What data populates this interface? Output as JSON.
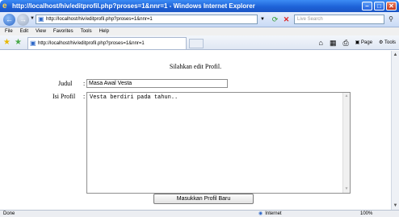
{
  "window": {
    "title": "http://localhost/hiv/editprofil.php?proses=1&nnr=1 - Windows Internet Explorer",
    "minimize_glyph": "–",
    "maximize_glyph": "□",
    "close_glyph": "✕"
  },
  "browser": {
    "address": "http://localhost/hiv/editprofil.php?proses=1&nnr=1",
    "search_placeholder": "Live Search",
    "menu": [
      "File",
      "Edit",
      "View",
      "Favorites",
      "Tools",
      "Help"
    ],
    "tab_title": "http://localhost/hiv/editprofil.php?proses=1&nnr=1",
    "cmd_page": "Page",
    "cmd_tools": "Tools",
    "status": "Done",
    "zone": "Internet",
    "zoom": "100%"
  },
  "form": {
    "heading": "Silahkan edit Profil.",
    "judul_label": "Judul",
    "judul_colon": ":",
    "judul_value": "Masa Awal Vesta",
    "profil_label": "Isi Profil",
    "profil_colon": ":",
    "profil_value": "Vesta berdiri pada tahun..",
    "submit_label": "Masukkan Profil Baru"
  },
  "icons": {
    "back": "back-arrow-icon",
    "forward": "forward-arrow-icon",
    "refresh": "refresh-icon",
    "stop": "stop-icon",
    "search": "search-icon",
    "favorites": "favorites-star-icon",
    "add_favorites": "add-favorites-icon",
    "home": "home-icon",
    "feeds": "feeds-icon",
    "print": "print-icon",
    "page": "page-icon",
    "tools": "tools-icon",
    "internet_zone": "globe-icon"
  }
}
